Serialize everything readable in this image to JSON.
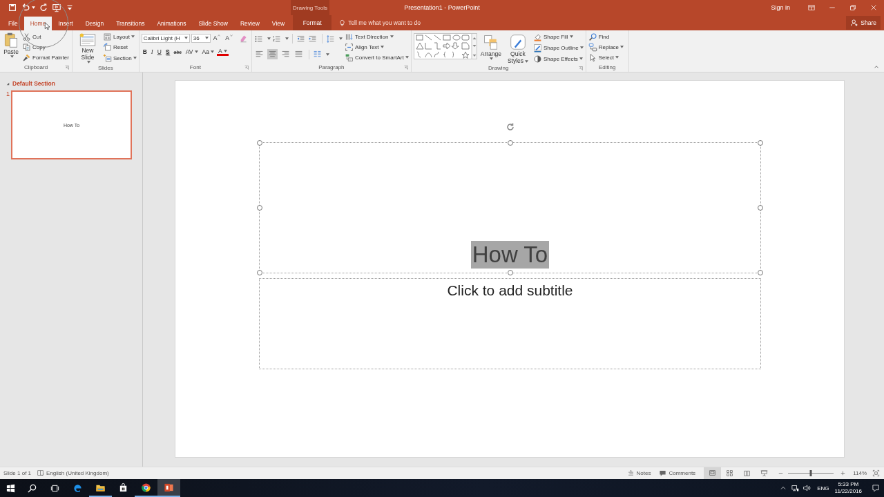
{
  "title_bar": {
    "context_label": "Drawing Tools",
    "title": "Presentation1 - PowerPoint",
    "sign_in": "Sign in"
  },
  "tabs": [
    {
      "label": "File",
      "selected": false,
      "kind": "normal"
    },
    {
      "label": "Home",
      "selected": true,
      "kind": "normal"
    },
    {
      "label": "Insert",
      "selected": false,
      "kind": "normal"
    },
    {
      "label": "Design",
      "selected": false,
      "kind": "normal"
    },
    {
      "label": "Transitions",
      "selected": false,
      "kind": "normal"
    },
    {
      "label": "Animations",
      "selected": false,
      "kind": "normal"
    },
    {
      "label": "Slide Show",
      "selected": false,
      "kind": "normal"
    },
    {
      "label": "Review",
      "selected": false,
      "kind": "normal"
    },
    {
      "label": "View",
      "selected": false,
      "kind": "normal"
    },
    {
      "label": "Format",
      "selected": false,
      "kind": "contextual"
    }
  ],
  "tell_me": {
    "placeholder": "Tell me what you want to do"
  },
  "share": "Share",
  "ribbon": {
    "clipboard": {
      "label": "Clipboard",
      "paste": "Paste",
      "items": [
        {
          "kind": "cut",
          "label": "Cut",
          "dropdown": false
        },
        {
          "kind": "copy",
          "label": "Copy",
          "dropdown": false
        },
        {
          "kind": "painter",
          "label": "Format Painter",
          "dropdown": false
        }
      ]
    },
    "slides": {
      "label": "Slides",
      "new_slide": "New Slide",
      "items": [
        {
          "kind": "layout",
          "label": "Layout",
          "dropdown": true
        },
        {
          "kind": "reset",
          "label": "Reset",
          "dropdown": false
        },
        {
          "kind": "section",
          "label": "Section",
          "dropdown": true
        }
      ]
    },
    "font": {
      "label": "Font",
      "font_name": "Calibri Light (H",
      "font_size": "36",
      "grow": "A",
      "shrink": "A",
      "buttons": [
        {
          "kind": "bold",
          "label": "B",
          "dropdown": false
        },
        {
          "kind": "italic",
          "label": "I",
          "dropdown": false
        },
        {
          "kind": "underline",
          "label": "U",
          "dropdown": false
        },
        {
          "kind": "shadow",
          "label": "S",
          "dropdown": false
        },
        {
          "kind": "strike",
          "label": "abc",
          "dropdown": false
        },
        {
          "kind": "spacing",
          "label": "AV",
          "dropdown": true
        },
        {
          "kind": "case",
          "label": "Aa",
          "dropdown": true
        },
        {
          "kind": "color",
          "label": "A",
          "dropdown": true
        }
      ]
    },
    "paragraph": {
      "label": "Paragraph",
      "alignment": [
        {
          "kind": "align_left",
          "selected": false
        },
        {
          "kind": "align_center",
          "selected": true
        },
        {
          "kind": "align_right",
          "selected": false
        },
        {
          "kind": "justify",
          "selected": false
        }
      ],
      "items": [
        {
          "kind": "text_direction",
          "label": "Text Direction",
          "dropdown": true
        },
        {
          "kind": "align_text",
          "label": "Align Text",
          "dropdown": true
        },
        {
          "kind": "smartart",
          "label": "Convert to SmartArt",
          "dropdown": true
        }
      ]
    },
    "drawing": {
      "label": "Drawing",
      "arrange": "Arrange",
      "quick_styles": "Quick Styles",
      "items": [
        {
          "kind": "fill",
          "label": "Shape Fill",
          "dropdown": true
        },
        {
          "kind": "outline",
          "label": "Shape Outline",
          "dropdown": true
        },
        {
          "kind": "effects",
          "label": "Shape Effects",
          "dropdown": true
        }
      ]
    },
    "editing": {
      "label": "Editing",
      "items": [
        {
          "kind": "find",
          "label": "Find",
          "dropdown": false
        },
        {
          "kind": "replace",
          "label": "Replace",
          "dropdown": true
        },
        {
          "kind": "select",
          "label": "Select",
          "dropdown": true
        }
      ]
    }
  },
  "slide_pane": {
    "section": "Default Section",
    "expanded": true,
    "slides": [
      {
        "number": "1",
        "title": "How To",
        "selected": true
      }
    ]
  },
  "slide": {
    "title": "How To",
    "title_selected": true,
    "subtitle_placeholder": "Click to add subtitle"
  },
  "status_bar": {
    "slide_info": "Slide 1 of 1",
    "language": "English (United Kingdom)",
    "notes": "Notes",
    "comments": "Comments",
    "views": [
      {
        "kind": "view_normal",
        "selected": true
      },
      {
        "kind": "view_sorter",
        "selected": false
      },
      {
        "kind": "view_reading",
        "selected": false
      },
      {
        "kind": "view_slideshow",
        "selected": false
      }
    ],
    "zoom": {
      "level": 0.5,
      "reading": "114%"
    }
  },
  "taskbar": {
    "apps": [
      {
        "kind": "edge",
        "running": false,
        "active": false
      },
      {
        "kind": "explorer",
        "running": true,
        "active": false
      },
      {
        "kind": "store",
        "running": false,
        "active": false
      },
      {
        "kind": "chrome",
        "running": true,
        "active": false
      },
      {
        "kind": "ppt",
        "running": true,
        "active": true
      }
    ],
    "language": "ENG",
    "time": "5:33 PM",
    "date": "11/22/2016"
  }
}
